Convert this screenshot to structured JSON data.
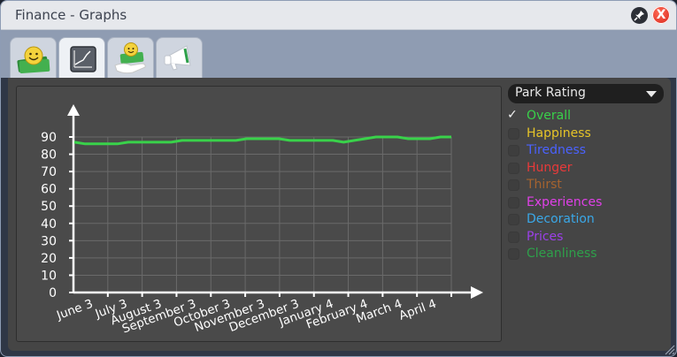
{
  "window": {
    "title": "Finance - Graphs"
  },
  "titlebar": {
    "pin_icon": "pin-icon",
    "close_label": "X",
    "close_color": "#d6241a"
  },
  "tabs": [
    {
      "name": "tab-finances",
      "icon": "money-smiley-icon",
      "active": false
    },
    {
      "name": "tab-graphs",
      "icon": "line-graph-icon",
      "active": true
    },
    {
      "name": "tab-income",
      "icon": "hand-money-icon",
      "active": false
    },
    {
      "name": "tab-marketing",
      "icon": "megaphone-icon",
      "active": false
    }
  ],
  "graph_selector": {
    "selected": "Park Rating"
  },
  "series_toggles": [
    {
      "label": "Overall",
      "color": "#39d24a",
      "checked": true
    },
    {
      "label": "Happiness",
      "color": "#e6c428",
      "checked": false
    },
    {
      "label": "Tiredness",
      "color": "#4a62ff",
      "checked": false
    },
    {
      "label": "Hunger",
      "color": "#e83a3a",
      "checked": false
    },
    {
      "label": "Thirst",
      "color": "#a5632f",
      "checked": false
    },
    {
      "label": "Experiences",
      "color": "#e040e8",
      "checked": false
    },
    {
      "label": "Decoration",
      "color": "#3aa8e8",
      "checked": false
    },
    {
      "label": "Prices",
      "color": "#9b40e8",
      "checked": false
    },
    {
      "label": "Cleanliness",
      "color": "#2ea04a",
      "checked": false
    }
  ],
  "chart_data": {
    "type": "line",
    "categories": [
      "June 3",
      "July 3",
      "August 3",
      "September 3",
      "October 3",
      "November 3",
      "December 3",
      "January 4",
      "February 4",
      "March 4",
      "April 4"
    ],
    "ylim": [
      0,
      90
    ],
    "yticks": [
      0,
      10,
      20,
      30,
      40,
      50,
      60,
      70,
      80,
      90
    ],
    "grid": true,
    "series": [
      {
        "color": "#39d24a",
        "values": [
          87,
          86,
          86,
          86,
          86,
          87,
          87,
          87,
          87,
          87,
          88,
          88,
          88,
          88,
          88,
          88,
          89,
          89,
          89,
          89,
          88,
          88,
          88,
          88,
          88,
          87,
          88,
          89,
          90,
          90,
          90,
          89,
          89,
          89,
          90,
          90
        ]
      }
    ]
  }
}
